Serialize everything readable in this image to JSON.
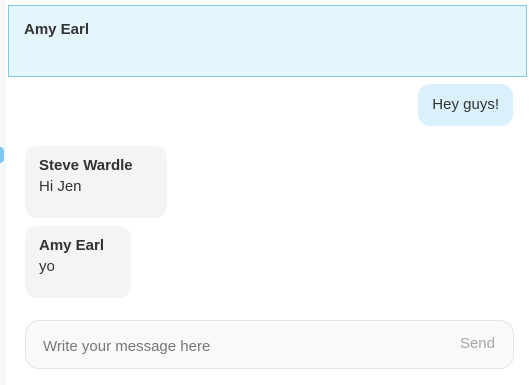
{
  "header": {
    "title": "Amy Earl"
  },
  "messages": [
    {
      "direction": "outgoing",
      "text": "Hey guys!"
    },
    {
      "direction": "incoming",
      "sender": "Steve Wardle",
      "text": "Hi Jen"
    },
    {
      "direction": "incoming",
      "sender": "Amy Earl",
      "text": "yo"
    }
  ],
  "composer": {
    "placeholder": "Write your message here",
    "value": "",
    "send_label": "Send"
  },
  "colors": {
    "header_bg": "#e5f5fc",
    "header_border": "#7fcdee",
    "outgoing_bubble": "#daf0fb",
    "incoming_bubble": "#f4f4f4"
  }
}
